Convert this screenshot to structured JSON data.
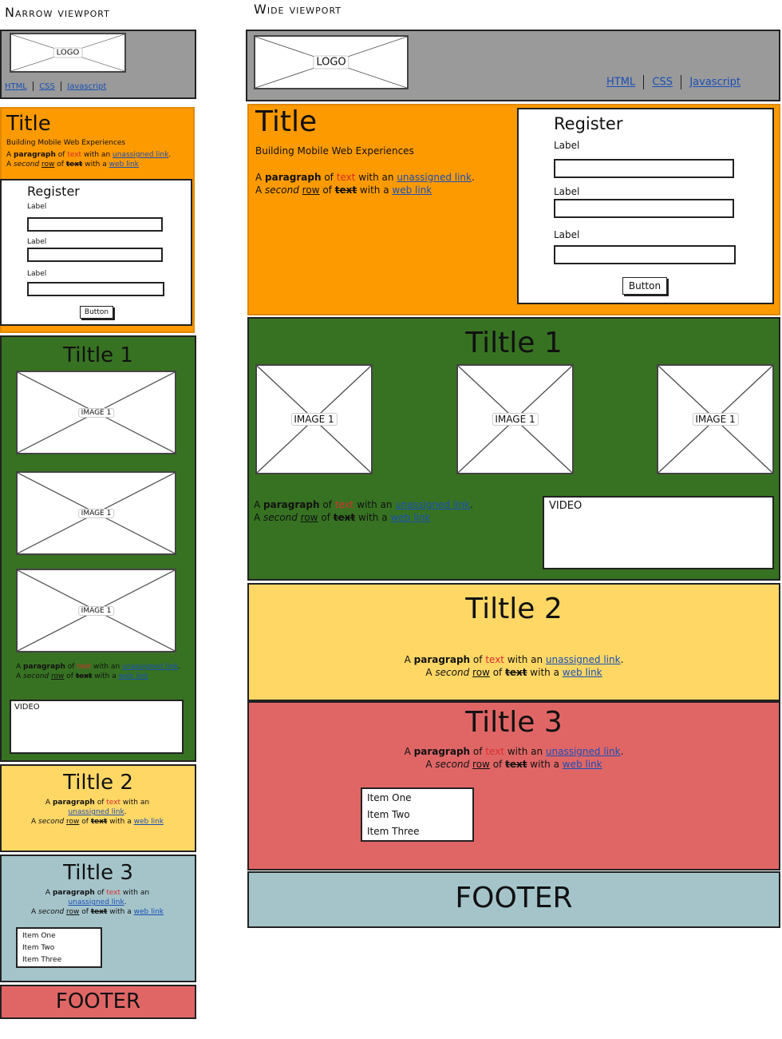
{
  "captions": {
    "narrow": "Narrow viewport",
    "wide": "Wide viewport"
  },
  "header": {
    "logo": "LOGO",
    "nav": [
      "HTML",
      "CSS",
      "Javascript"
    ]
  },
  "intro": {
    "title": "Title",
    "subtitle": "Building Mobile Web Experiences"
  },
  "paragraph": {
    "w1": "A",
    "w2": "paragraph",
    "w3": "of",
    "w4": "text",
    "w5": "with an",
    "w6": "unassigned link",
    "w7": ".",
    "r1": "A",
    "r2": "second",
    "r3": "row",
    "r4": "of",
    "r5": "text",
    "r6": "with a",
    "r7": "web link"
  },
  "register": {
    "title": "Register",
    "fields": [
      "Label",
      "Label",
      "Label"
    ],
    "button": "Button"
  },
  "section1": {
    "title": "Tiltle 1",
    "images": [
      "IMAGE 1",
      "IMAGE 1",
      "IMAGE 1"
    ],
    "video": "VIDEO"
  },
  "section2": {
    "title": "Tiltle 2"
  },
  "section3": {
    "title": "Tiltle 3",
    "list": [
      "Item One",
      "Item Two",
      "Item Three"
    ]
  },
  "footer": {
    "label": "FOOTER"
  },
  "colors": {
    "header": "#9a9a9a",
    "intro": "#fd9a00",
    "section1": "#377222",
    "section2": "#fed765",
    "section3_wide": "#e06666",
    "section3_narrow": "#a4c4ca",
    "footer_wide": "#a4c4ca",
    "footer_narrow": "#e06666"
  }
}
